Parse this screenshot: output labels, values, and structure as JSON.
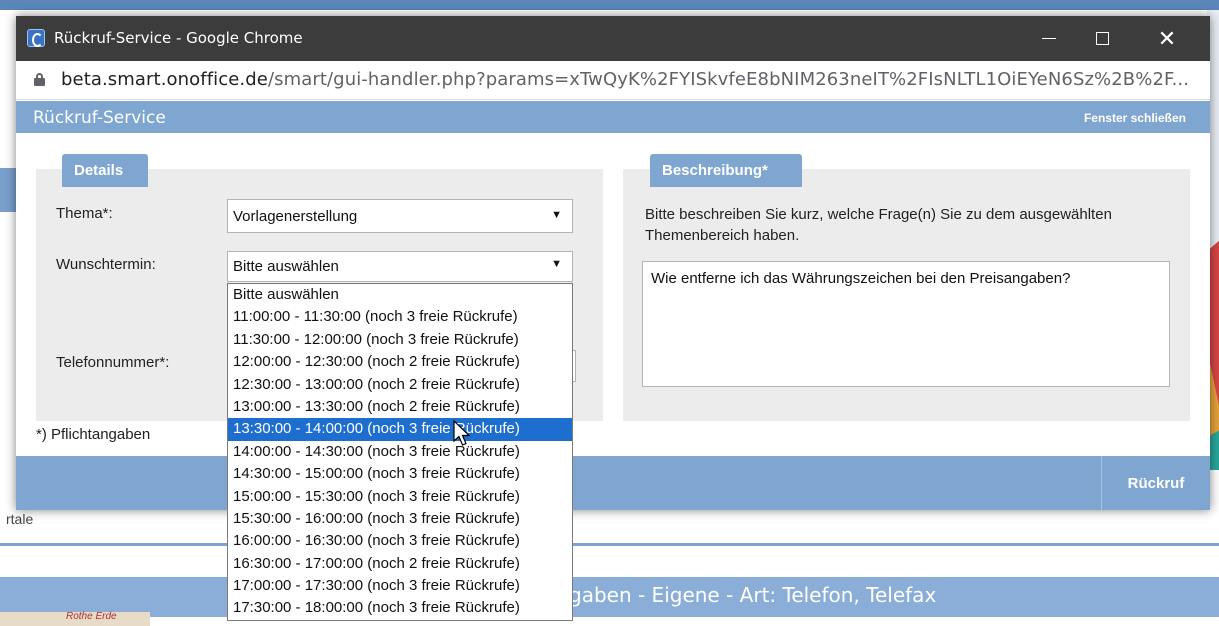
{
  "background": {
    "left_label": "rtale",
    "bottom_bar_text": "gaben - Eigene - Art: Telefon, Telefax",
    "map_label": "Rothe Erde"
  },
  "window": {
    "title": "Rückruf-Service - Google Chrome",
    "url_host": "beta.smart.onoffice.de",
    "url_path": "/smart/gui-handler.php?params=xTwQyK%2FYISkvfeE8bNIM263neIT%2FIsNLTL1OiEYeN6Sz%2B%2F..."
  },
  "dialog": {
    "title": "Rückruf-Service",
    "close_link": "Fenster schließen",
    "details_tab": "Details",
    "description_tab": "Beschreibung*",
    "labels": {
      "thema": "Thema*:",
      "wunschtermin": "Wunschtermin:",
      "telefon": "Telefonnummer*:"
    },
    "thema_value": "Vorlagenerstellung",
    "wunschtermin_value": "Bitte auswählen",
    "description_prompt": "Bitte beschreiben Sie kurz, welche Frage(n) Sie zu dem ausgewählten Themenbereich haben.",
    "description_value": "Wie entferne ich das Währungszeichen bei den Preisangaben?",
    "required_note": "*) Pflichtangaben",
    "submit_button": "Rückruf"
  },
  "dropdown": {
    "highlighted_index": 6,
    "options": [
      "Bitte auswählen",
      "11:00:00 - 11:30:00 (noch 3 freie Rückrufe)",
      "11:30:00 - 12:00:00 (noch 3 freie Rückrufe)",
      "12:00:00 - 12:30:00 (noch 2 freie Rückrufe)",
      "12:30:00 - 13:00:00 (noch 2 freie Rückrufe)",
      "13:00:00 - 13:30:00 (noch 2 freie Rückrufe)",
      "13:30:00 - 14:00:00 (noch 3 freie Rückrufe)",
      "14:00:00 - 14:30:00 (noch 3 freie Rückrufe)",
      "14:30:00 - 15:00:00 (noch 3 freie Rückrufe)",
      "15:00:00 - 15:30:00 (noch 3 freie Rückrufe)",
      "15:30:00 - 16:00:00 (noch 3 freie Rückrufe)",
      "16:00:00 - 16:30:00 (noch 3 freie Rückrufe)",
      "16:30:00 - 17:00:00 (noch 2 freie Rückrufe)",
      "17:00:00 - 17:30:00 (noch 3 freie Rückrufe)",
      "17:30:00 - 18:00:00 (noch 3 freie Rückrufe)"
    ]
  },
  "colors": {
    "header_blue": "#7fa5d1",
    "selection_blue": "#1e6ed0",
    "titlebar": "#3c3c3c"
  }
}
